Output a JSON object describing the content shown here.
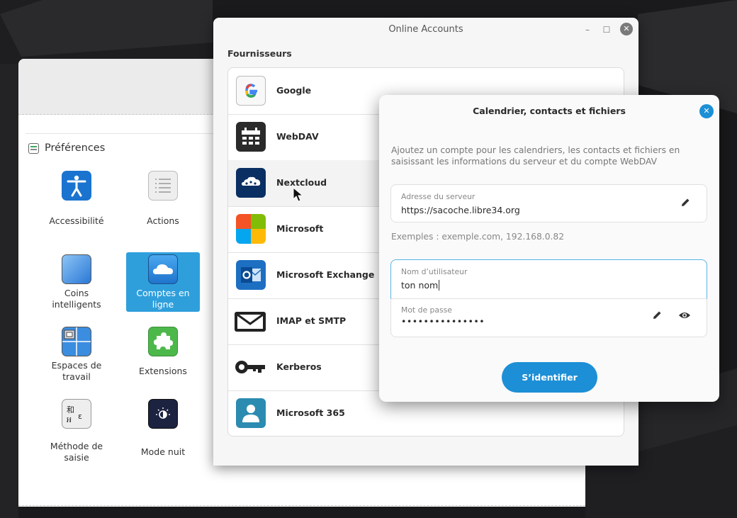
{
  "prefs": {
    "title": "Préférences",
    "tiles": [
      {
        "label": "Accessibilité",
        "icon": "accessibility-icon"
      },
      {
        "label": "Actions",
        "icon": "actions-list-icon"
      },
      {
        "label": "Coins\nintelligents",
        "icon": "hot-corners-icon"
      },
      {
        "label": "Comptes en\nligne",
        "icon": "cloud-icon",
        "selected": true
      },
      {
        "label": "Espaces de\ntravail",
        "icon": "workspaces-icon"
      },
      {
        "label": "Extensions",
        "icon": "puzzle-icon"
      },
      {
        "label": "Méthode de\nsaisie",
        "icon": "input-method-icon"
      },
      {
        "label": "Mode nuit",
        "icon": "night-mode-icon"
      }
    ]
  },
  "online_accounts": {
    "title": "Online Accounts",
    "section": "Fournisseurs",
    "providers": [
      {
        "name": "Google",
        "icon": "google-icon"
      },
      {
        "name": "WebDAV",
        "icon": "webdav-calendar-icon"
      },
      {
        "name": "Nextcloud",
        "icon": "nextcloud-icon"
      },
      {
        "name": "Microsoft",
        "icon": "microsoft-icon"
      },
      {
        "name": "Microsoft Exchange",
        "icon": "exchange-icon"
      },
      {
        "name": "IMAP et SMTP",
        "icon": "mail-envelope-icon"
      },
      {
        "name": "Kerberos",
        "icon": "key-icon"
      },
      {
        "name": "Microsoft 365",
        "icon": "user-account-icon"
      }
    ]
  },
  "dialog": {
    "title": "Calendrier, contacts et fichiers",
    "description": "Ajoutez un compte pour les calendriers, les contacts et fichiers en saisissant les informations du serveur et du compte WebDAV",
    "server": {
      "label": "Adresse du serveur",
      "value": "https://sacoche.libre34.org"
    },
    "hint": "Exemples : exemple.com, 192.168.0.82",
    "username": {
      "label": "Nom d’utilisateur",
      "value": "ton nom"
    },
    "password": {
      "label": "Mot de passe",
      "value": "•••••••••••••••"
    },
    "submit": "S’identifier"
  },
  "colors": {
    "accent": "#1c8fd6",
    "selected_tile": "#2f9fdc"
  }
}
